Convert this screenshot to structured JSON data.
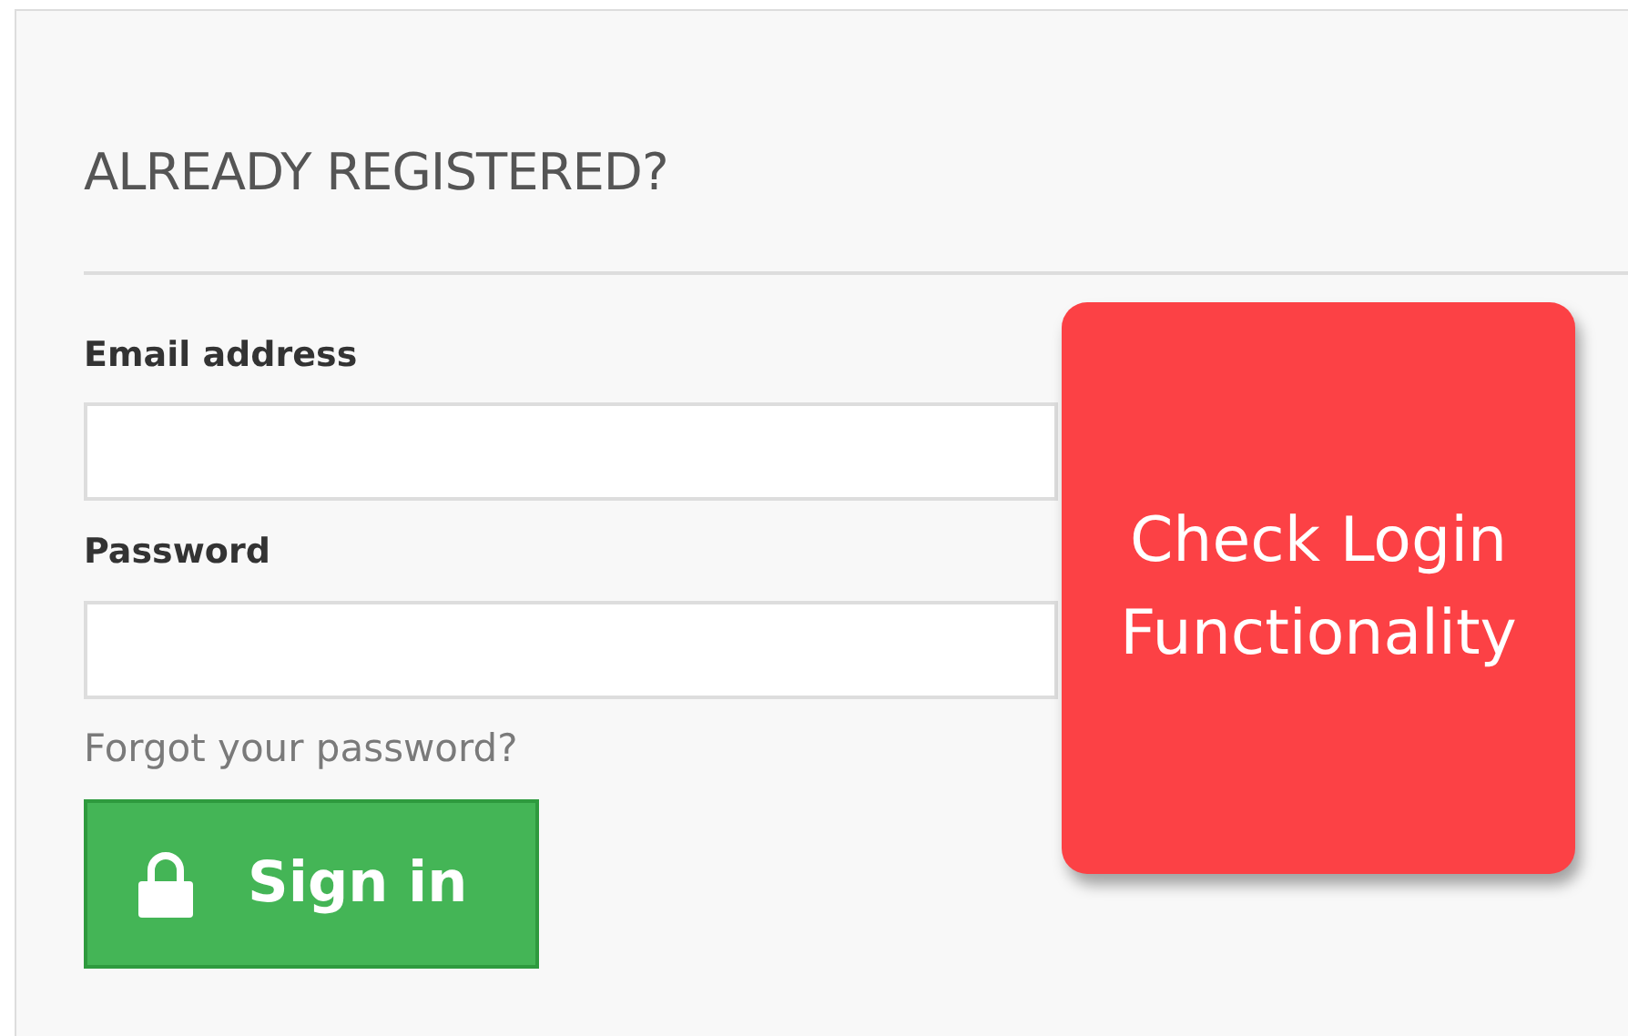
{
  "heading": "ALREADY REGISTERED?",
  "fields": [
    {
      "label": "Email address"
    },
    {
      "label": "Password"
    }
  ],
  "forgot_link": "Forgot your password?",
  "sign_in_button": {
    "label": "Sign in"
  },
  "sticky_note": {
    "text": "Check Login Functionality"
  }
}
